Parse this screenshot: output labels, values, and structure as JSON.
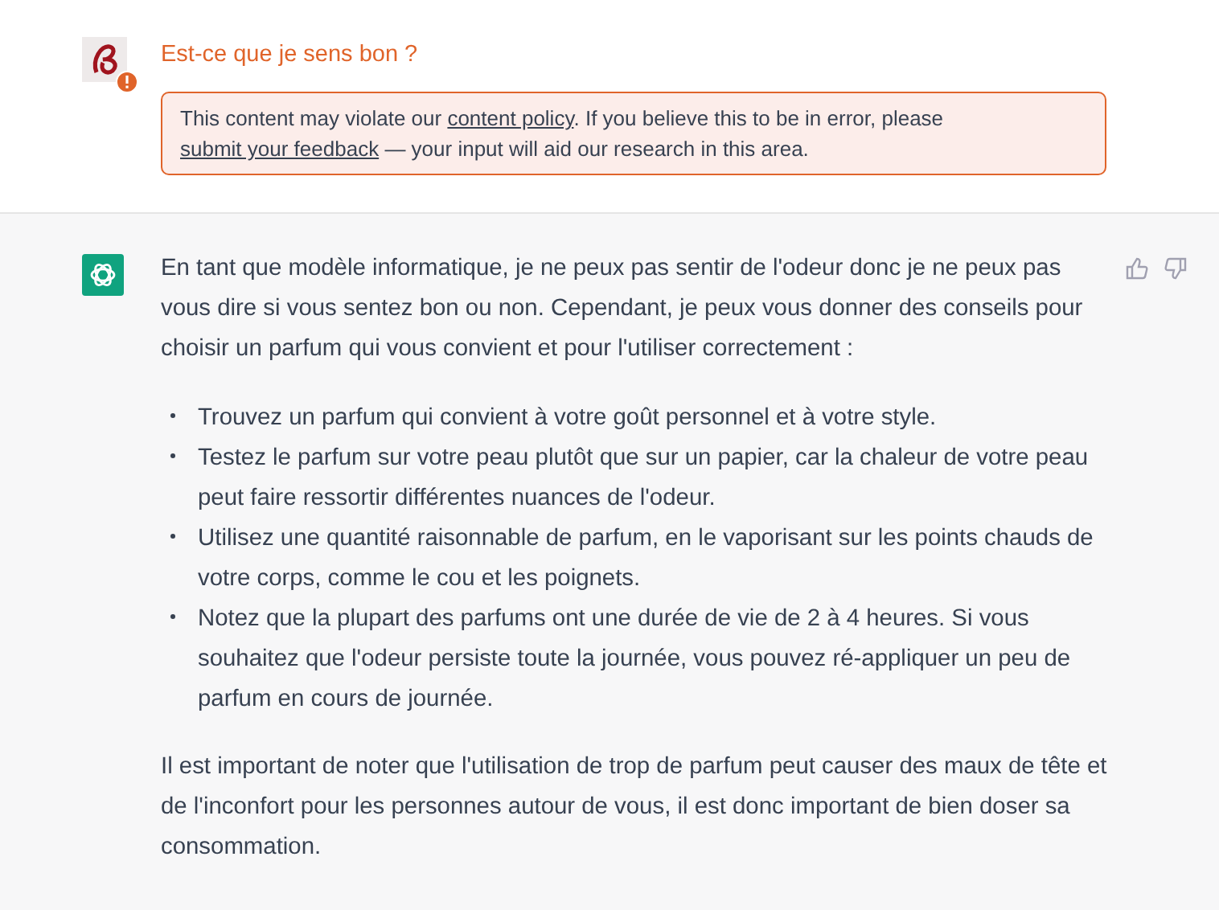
{
  "user_message": {
    "text": "Est-ce que je sens bon ?",
    "flagged": true,
    "warning": [
      {
        "text": "This content may violate our ",
        "link": false
      },
      {
        "text": "content policy",
        "link": true
      },
      {
        "text": ". If you believe this to be in error, please ",
        "link": false
      },
      {
        "text": "submit your feedback",
        "link": true
      },
      {
        "text": " — your input will aid our research in this area.",
        "link": false
      }
    ]
  },
  "assistant_message": {
    "intro": "En tant que modèle informatique, je ne peux pas sentir de l'odeur donc je ne peux pas vous dire si vous sentez bon ou non. Cependant, je peux vous donner des conseils pour choisir un parfum qui vous convient et pour l'utiliser correctement :",
    "bullets": [
      "Trouvez un parfum qui convient à votre goût personnel et à votre style.",
      "Testez le parfum sur votre peau plutôt que sur un papier, car la chaleur de votre peau peut faire ressortir différentes nuances de l'odeur.",
      "Utilisez une quantité raisonnable de parfum, en le vaporisant sur les points chauds de votre corps, comme le cou et les poignets.",
      "Notez que la plupart des parfums ont une durée de vie de 2 à 4 heures. Si vous souhaitez que l'odeur persiste toute la journée, vous pouvez ré-appliquer un peu de parfum en cours de journée."
    ],
    "conclusion": "Il est important de noter que l'utilisation de trop de parfum peut causer des maux de tête et de l'inconfort pour les personnes autour de vous, il est donc important de bien doser sa consommation."
  }
}
